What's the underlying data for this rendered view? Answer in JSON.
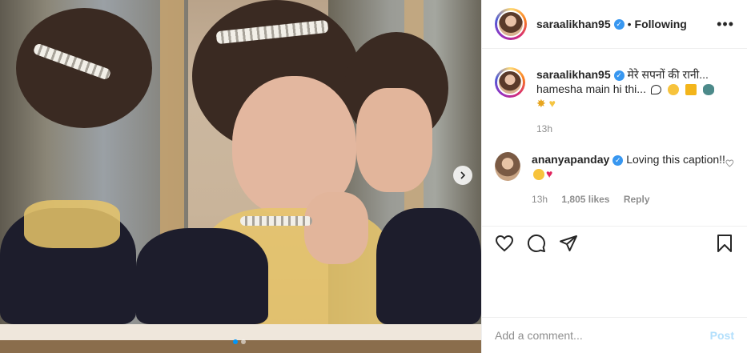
{
  "header": {
    "username": "saraalikhan95",
    "separator": "•",
    "following_label": "Following",
    "more_icon": "more-horizontal-icon"
  },
  "caption": {
    "username": "saraalikhan95",
    "line1": "मेरे सपनों की रानी...",
    "line2": "hamesha main hi thi...",
    "emojis_line2": [
      "speech-bubble-icon",
      "thinking-face-emoji",
      "film-clap-emoji",
      "flying-saucer-emoji"
    ],
    "emojis_line3": [
      "dizzy-star-emoji",
      "yellow-heart-emoji"
    ],
    "time": "13h"
  },
  "comment": {
    "username": "ananyapanday",
    "text": "Loving this caption!!",
    "emojis": [
      "laughing-tears-emoji",
      "red-heart-emoji"
    ],
    "time": "13h",
    "likes": "1,805 likes",
    "reply_label": "Reply"
  },
  "add_comment": {
    "placeholder": "Add a comment...",
    "post_label": "Post"
  },
  "colors": {
    "verified": "#3897f0",
    "active_dot": "#0095f6",
    "post_disabled": "#b2dffc"
  },
  "carousel": {
    "slides": 2,
    "active_index": 0
  }
}
